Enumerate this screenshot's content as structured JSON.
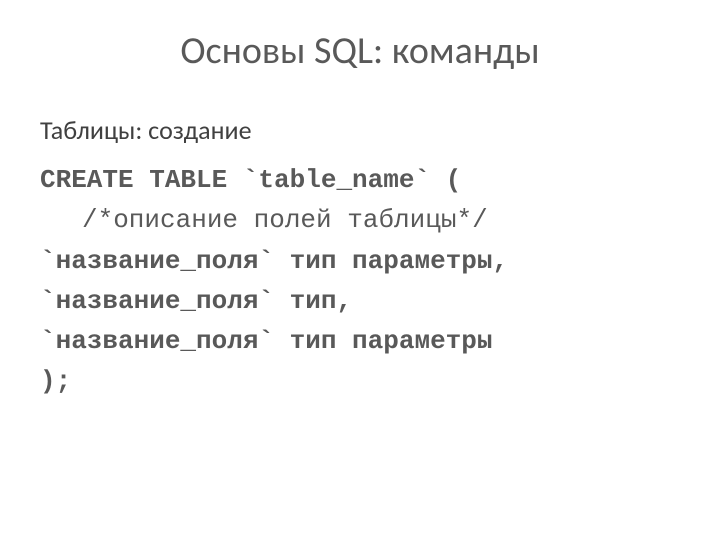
{
  "title": "Основы SQL: команды",
  "subtitle": "Таблицы: создание",
  "code": {
    "line1": "CREATE TABLE `table_name` (",
    "line2": "/*описание полей таблицы*/",
    "line3": "`название_поля` тип параметры,",
    "line4": "`название_поля` тип,",
    "line5": "`название_поля` тип параметры",
    "line6": ");"
  }
}
